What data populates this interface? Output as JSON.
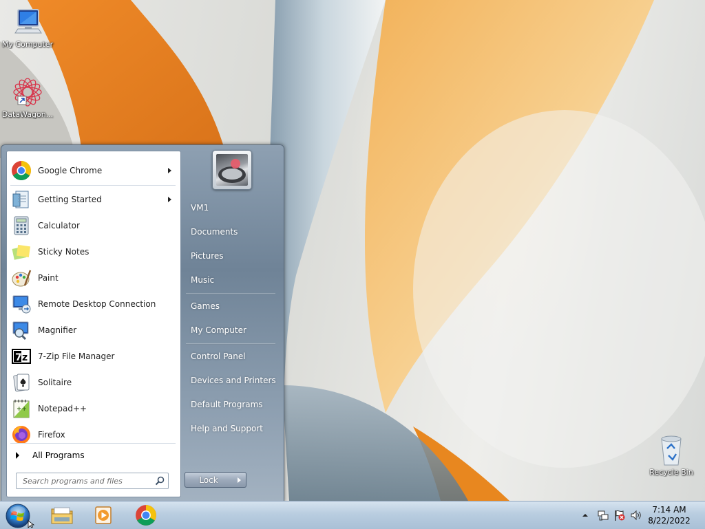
{
  "desktop": {
    "icons": [
      {
        "label": "My Computer"
      },
      {
        "label": "DataWagon..."
      },
      {
        "label": "Recycle Bin"
      }
    ]
  },
  "start_menu": {
    "pinned": [
      {
        "label": "Google Chrome",
        "icon": "chrome-icon",
        "has_submenu": true
      },
      {
        "label": "Getting Started",
        "icon": "getting-started-icon",
        "has_submenu": true
      },
      {
        "label": "Calculator",
        "icon": "calculator-icon"
      },
      {
        "label": "Sticky Notes",
        "icon": "sticky-notes-icon"
      },
      {
        "label": "Paint",
        "icon": "paint-icon"
      },
      {
        "label": "Remote Desktop Connection",
        "icon": "remote-desktop-icon"
      },
      {
        "label": "Magnifier",
        "icon": "magnifier-icon"
      },
      {
        "label": "7-Zip File Manager",
        "icon": "seven-zip-icon"
      },
      {
        "label": "Solitaire",
        "icon": "solitaire-icon"
      },
      {
        "label": "Notepad++",
        "icon": "notepad-plus-plus-icon"
      },
      {
        "label": "Firefox",
        "icon": "firefox-icon"
      }
    ],
    "all_programs_label": "All Programs",
    "search_placeholder": "Search programs and files",
    "right_items": [
      {
        "label": "VM1"
      },
      {
        "label": "Documents"
      },
      {
        "label": "Pictures"
      },
      {
        "label": "Music"
      },
      {
        "label": "Games"
      },
      {
        "label": "My Computer"
      },
      {
        "label": "Control Panel"
      },
      {
        "label": "Devices and Printers"
      },
      {
        "label": "Default Programs"
      },
      {
        "label": "Help and Support"
      }
    ],
    "lock_label": "Lock"
  },
  "taskbar": {
    "pinned": [
      "windows-explorer-icon",
      "media-player-icon",
      "chrome-icon"
    ],
    "tray_icons": [
      "show-hidden-icons-icon",
      "network-icon",
      "action-center-flag-icon",
      "volume-icon"
    ],
    "time": "7:14 AM",
    "date": "8/22/2022"
  },
  "colors": {
    "accent_orange": "#e98a2a",
    "start_menu_frame": "#7b8ea2",
    "taskbar": "#b9cde0"
  }
}
